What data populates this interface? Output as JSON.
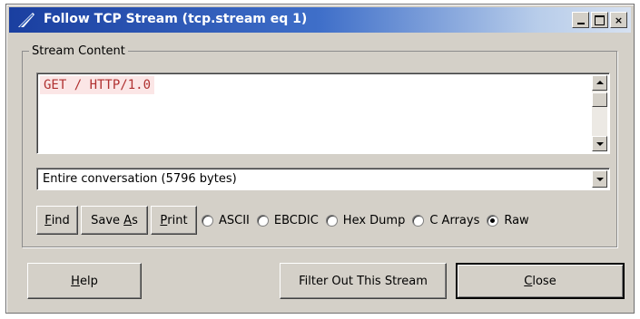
{
  "window": {
    "title": "Follow TCP Stream (tcp.stream eq 1)",
    "controls": {
      "minimize": "",
      "maximize": "",
      "close": "×"
    }
  },
  "stream": {
    "group_label": "Stream Content",
    "content": "GET / HTTP/1.0",
    "content_color": "#b03030"
  },
  "conversation": {
    "selected": "Entire conversation (5796 bytes)"
  },
  "actions": {
    "find": {
      "hotkey": "F",
      "rest": "ind"
    },
    "save_as": {
      "pre": "Save ",
      "hotkey": "A",
      "rest": "s"
    },
    "print": {
      "hotkey": "P",
      "rest": "rint"
    }
  },
  "formats": [
    {
      "label": "ASCII",
      "checked": false
    },
    {
      "label": "EBCDIC",
      "checked": false
    },
    {
      "label": "Hex Dump",
      "checked": false
    },
    {
      "label": "C Arrays",
      "checked": false
    },
    {
      "label": "Raw",
      "checked": true
    }
  ],
  "footer": {
    "help": {
      "hotkey": "H",
      "rest": "elp"
    },
    "filter_out": "Filter Out This Stream",
    "close": {
      "hotkey": "C",
      "rest": "lose"
    }
  },
  "colors": {
    "title_gradient_start": "#1a3fa0",
    "title_gradient_end": "#d6e1f1",
    "window_bg": "#d4d0c8"
  }
}
